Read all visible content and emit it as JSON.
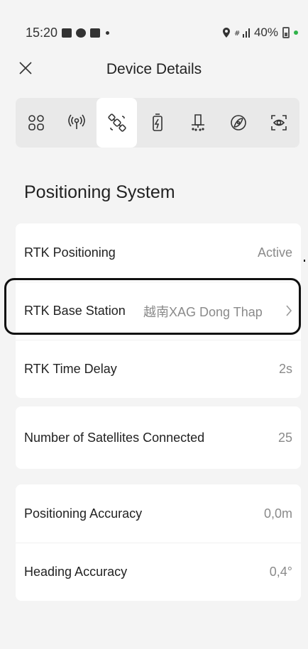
{
  "status": {
    "time": "15:20",
    "battery": "40%"
  },
  "header": {
    "title": "Device Details"
  },
  "tabs": [
    {
      "icon": "grid-icon",
      "active": false
    },
    {
      "icon": "signal-icon",
      "active": false
    },
    {
      "icon": "satellite-icon",
      "active": true
    },
    {
      "icon": "battery-icon",
      "active": false
    },
    {
      "icon": "sprayer-icon",
      "active": false
    },
    {
      "icon": "propeller-icon",
      "active": false
    },
    {
      "icon": "camera-scan-icon",
      "active": false
    }
  ],
  "section": {
    "title": "Positioning System"
  },
  "card1": {
    "rows": [
      {
        "label": "RTK Positioning",
        "value": "Active"
      },
      {
        "label": "RTK Base Station",
        "value": "越南XAG Dong Thap"
      },
      {
        "label": "RTK Time Delay",
        "value": "2s"
      }
    ]
  },
  "card2": {
    "rows": [
      {
        "label": "Number of Satellites Connected",
        "value": "25"
      }
    ]
  },
  "card3": {
    "rows": [
      {
        "label": "Positioning Accuracy",
        "value": "0,0m"
      },
      {
        "label": "Heading Accuracy",
        "value": "0,4°"
      }
    ]
  },
  "colors": {
    "background": "#f4f4f4",
    "card": "#ffffff",
    "tab_bar": "#e9e9e9",
    "value_text": "#8a8a8a",
    "charge": "#2fb34a"
  }
}
